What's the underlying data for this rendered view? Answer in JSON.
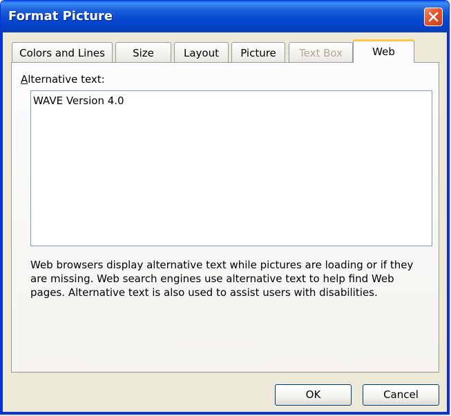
{
  "window": {
    "title": "Format Picture"
  },
  "tabs": [
    {
      "label": "Colors and Lines",
      "state": "normal"
    },
    {
      "label": "Size",
      "state": "normal"
    },
    {
      "label": "Layout",
      "state": "normal"
    },
    {
      "label": "Picture",
      "state": "normal"
    },
    {
      "label": "Text Box",
      "state": "disabled"
    },
    {
      "label": "Web",
      "state": "active"
    }
  ],
  "web": {
    "alt_label_accel": "A",
    "alt_label_rest": "lternative text:",
    "alt_value": "WAVE Version 4.0",
    "help_text": "Web browsers display alternative text while pictures are loading or if they are missing.   Web search engines use alternative text to help find Web pages.  Alternative text is also used to assist users with disabilities."
  },
  "buttons": {
    "ok": "OK",
    "cancel": "Cancel"
  },
  "colors": {
    "title_bar": "#0648d0",
    "active_tab_accent": "#ffc83c",
    "close_button": "#e2542e",
    "dialog_bg": "#ece9d8"
  }
}
